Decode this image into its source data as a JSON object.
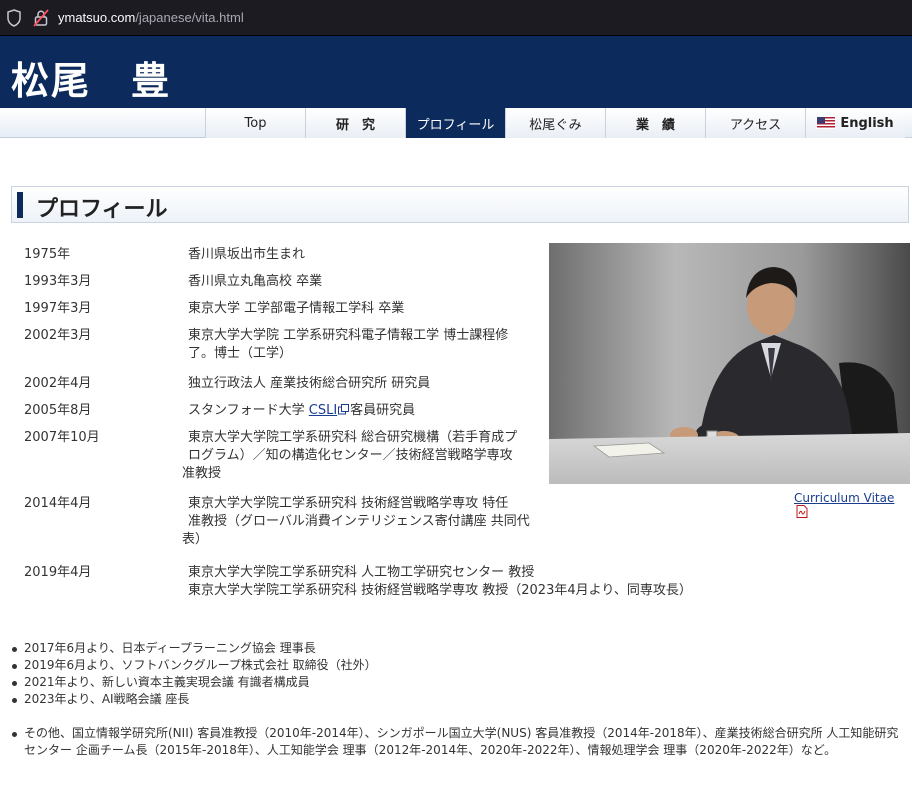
{
  "browser": {
    "url_host": "ymatsuo.com",
    "url_path": "/japanese/vita.html",
    "shield_icon": "shield-icon",
    "lock_icon": "lock-warning-icon"
  },
  "site": {
    "title": "松尾　豊"
  },
  "nav": {
    "items": [
      {
        "label": "Top"
      },
      {
        "label": "研　究"
      },
      {
        "label": "プロフィール"
      },
      {
        "label": "松尾ぐみ"
      },
      {
        "label": "業　績"
      },
      {
        "label": "アクセス"
      },
      {
        "label": "English"
      }
    ],
    "active_index": 2
  },
  "page": {
    "heading": "プロフィール"
  },
  "history": [
    {
      "year": "1975年",
      "lines": [
        "香川県坂出市生まれ"
      ]
    },
    {
      "year": "1993年3月",
      "lines": [
        "香川県立丸亀高校 卒業"
      ]
    },
    {
      "year": "1997年3月",
      "lines": [
        "東京大学 工学部電子情報工学科 卒業"
      ]
    },
    {
      "year": "2002年3月",
      "lines": [
        "東京大学大学院 工学系研究科電子情報工学 博士課程修",
        "了。博士（工学）"
      ]
    },
    {
      "year": "2002年4月",
      "lines": [
        "独立行政法人 産業技術総合研究所 研究員"
      ]
    },
    {
      "year": "2005年8月",
      "pre": "スタンフォード大学 ",
      "link": "CSLI",
      "post": "客員研究員"
    },
    {
      "year": "2007年10月",
      "lines": [
        "東京大学大学院工学系研究科 総合研究機構（若手育成プ",
        "ログラム）／知の構造化センター／技術経営戦略学専攻",
        "准教授"
      ]
    },
    {
      "year": "2014年4月",
      "lines": [
        "東京大学大学院工学系研究科 技術経営戦略学専攻 特任",
        "准教授（グローバル消費インテリジェンス寄付講座 共同代",
        "表）"
      ]
    },
    {
      "year": "2019年4月",
      "lines": [
        "東京大学大学院工学系研究科 人工物工学研究センター 教授",
        "東京大学大学院工学系研究科 技術経営戦略学専攻 教授（2023年4月より、同専攻長）"
      ]
    }
  ],
  "cv": {
    "label": "Curriculum Vitae",
    "icon": "pdf-icon"
  },
  "positions": [
    "2017年6月より、日本ディープラーニング協会 理事長",
    "2019年6月より、ソフトバンクグループ株式会社 取締役（社外）",
    "2021年より、新しい資本主義実現会議 有識者構成員",
    "2023年より、AI戦略会議 座長"
  ],
  "others": "その他、国立情報学研究所(NII) 客員准教授（2010年-2014年）、シンガポール国立大学(NUS) 客員准教授（2014年-2018年）、産業技術総合研究所 人工知能研究センター 企画チーム長（2015年-2018年）、人工知能学会 理事（2012年-2014年、2020年-2022年）、情報処理学会 理事（2020年-2022年）など。",
  "colors": {
    "brand_navy": "#0c2a5c",
    "link": "#1a3d8f"
  }
}
